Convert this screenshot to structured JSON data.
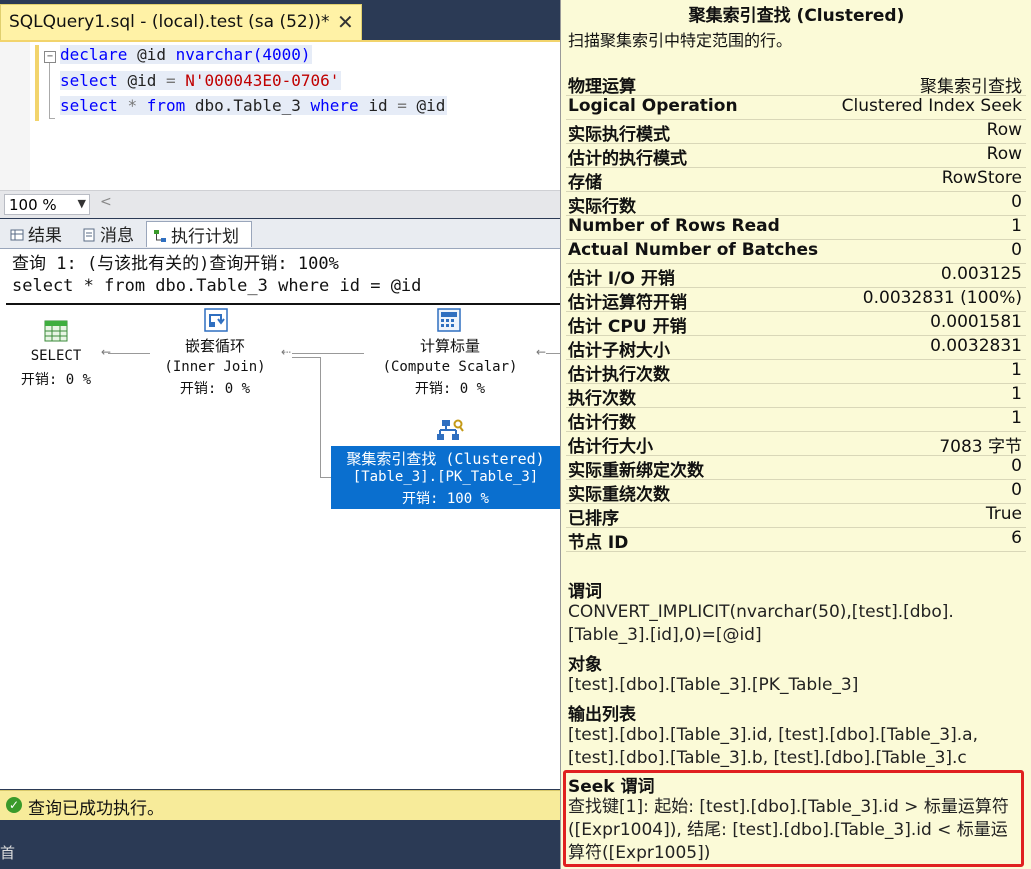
{
  "document_tab": {
    "title": "SQLQuery1.sql - (local).test (sa (52))*",
    "close_glyph": "✕"
  },
  "editor": {
    "collapse_glyph": "−",
    "lines": [
      [
        "declare",
        "@id",
        "nvarchar(4000)"
      ],
      [
        "select",
        "@id",
        "=",
        "N'000043E0-0706'"
      ],
      [
        "select",
        "*",
        "from",
        "dbo.Table_3",
        "where",
        "id",
        "=",
        "@id"
      ]
    ]
  },
  "zoom": {
    "value": "100 %",
    "arrow": "▼",
    "scroll_left": "<"
  },
  "result_tabs": [
    {
      "label": "结果",
      "icon": "grid-icon"
    },
    {
      "label": "消息",
      "icon": "message-icon"
    },
    {
      "label": "执行计划",
      "icon": "execution-plan-icon",
      "active": true
    }
  ],
  "plan": {
    "header_line1": "查询 1: (与该批有关的)查询开销: 100%",
    "header_line2": "select * from dbo.Table_3 where id = @id",
    "nodes": {
      "select": {
        "name": "SELECT",
        "cost": "开销: 0 %",
        "icon": "select-result-icon"
      },
      "nested_loops": {
        "name": "嵌套循环",
        "detail": "(Inner Join)",
        "cost": "开销: 0 %",
        "icon": "nested-loops-icon"
      },
      "compute_scalar": {
        "name": "计算标量",
        "detail": "(Compute Scalar)",
        "cost": "开销: 0 %",
        "icon": "compute-scalar-icon"
      },
      "index_seek": {
        "name": "聚集索引查找 (Clustered)",
        "detail": "[Table_3].[PK_Table_3]",
        "cost": "开销: 100 %",
        "icon": "clustered-index-seek-icon",
        "selected_color": "#0a6fcf"
      }
    }
  },
  "status": {
    "text": "查询已成功执行。",
    "icon": "success-check-icon",
    "check_glyph": "✓"
  },
  "bottom_glyph": "首",
  "tooltip": {
    "title": "聚集索引查找 (Clustered)",
    "description": "扫描聚集索引中特定范围的行。",
    "properties": [
      {
        "name": "物理运算",
        "value": "聚集索引查找"
      },
      {
        "name": "Logical Operation",
        "value": "Clustered Index Seek"
      },
      {
        "name": "实际执行模式",
        "value": "Row"
      },
      {
        "name": "估计的执行模式",
        "value": "Row"
      },
      {
        "name": "存储",
        "value": "RowStore"
      },
      {
        "name": "实际行数",
        "value": "0"
      },
      {
        "name": "Number of Rows Read",
        "value": "1"
      },
      {
        "name": "Actual Number of Batches",
        "value": "0"
      },
      {
        "name": "估计 I/O 开销",
        "value": "0.003125"
      },
      {
        "name": "估计运算符开销",
        "value": "0.0032831 (100%)"
      },
      {
        "name": "估计 CPU 开销",
        "value": "0.0001581"
      },
      {
        "name": "估计子树大小",
        "value": "0.0032831"
      },
      {
        "name": "估计执行次数",
        "value": "1"
      },
      {
        "name": "执行次数",
        "value": "1"
      },
      {
        "name": "估计行数",
        "value": "1"
      },
      {
        "name": "估计行大小",
        "value": "7083 字节"
      },
      {
        "name": "实际重新绑定次数",
        "value": "0"
      },
      {
        "name": "实际重绕次数",
        "value": "0"
      },
      {
        "name": "已排序",
        "value": "True"
      },
      {
        "name": "节点 ID",
        "value": "6"
      }
    ],
    "predicate": {
      "title": "谓词",
      "text": "CONVERT_IMPLICIT(nvarchar(50),[test].[dbo].[Table_3].[id],0)=[@id]"
    },
    "object": {
      "title": "对象",
      "text": "[test].[dbo].[Table_3].[PK_Table_3]"
    },
    "output_list": {
      "title": "输出列表",
      "text": "[test].[dbo].[Table_3].id, [test].[dbo].[Table_3].a, [test].[dbo].[Table_3].b, [test].[dbo].[Table_3].c"
    },
    "seek_predicate": {
      "title": "Seek 谓词",
      "text": "查找键[1]: 起始: [test].[dbo].[Table_3].id > 标量运算符([Expr1004]), 结尾: [test].[dbo].[Table_3].id < 标量运算符([Expr1005])",
      "highlight_color": "#e02020"
    }
  }
}
